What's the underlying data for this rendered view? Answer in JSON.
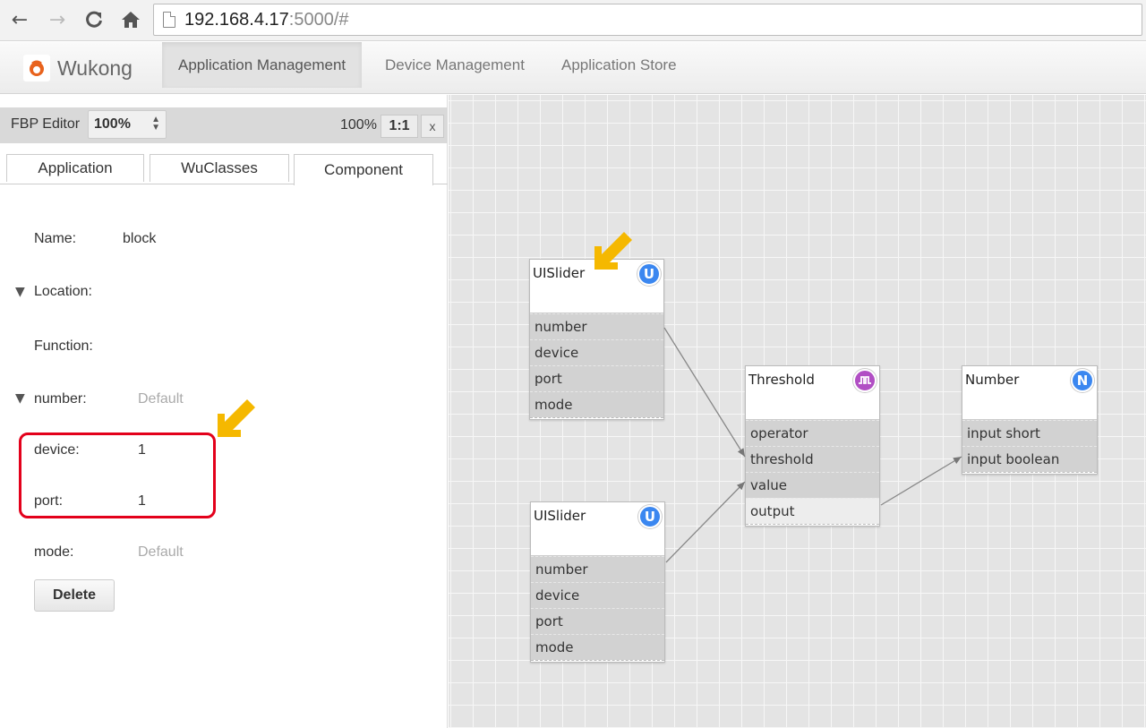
{
  "browser": {
    "back_icon": "arrow-left-icon",
    "forward_icon": "arrow-right-icon",
    "reload_icon": "reload-icon",
    "home_icon": "home-icon",
    "url_host": "192.168.4.17",
    "url_rest": ":5000/#"
  },
  "navbar": {
    "brand": "Wukong",
    "items": [
      {
        "label": "Application Management",
        "active": true
      },
      {
        "label": "Device Management",
        "active": false
      },
      {
        "label": "Application Store",
        "active": false
      }
    ]
  },
  "editor": {
    "label": "FBP Editor",
    "zoom_select": "100%",
    "zoom_pct": "100%",
    "ratio_button": "1:1",
    "close_button": "x",
    "tabs": [
      {
        "label": "Application",
        "active": false
      },
      {
        "label": "WuClasses",
        "active": false
      },
      {
        "label": "Component",
        "active": true
      }
    ]
  },
  "component": {
    "name_label": "Name:",
    "name_value": "block",
    "location_label": "Location:",
    "function_label": "Function:",
    "number_label": "number:",
    "number_value": "Default",
    "device_label": "device:",
    "device_value": "1",
    "port_label": "port:",
    "port_value": "1",
    "mode_label": "mode:",
    "mode_value": "Default",
    "delete_button": "Delete"
  },
  "blocks": [
    {
      "id": "slider1",
      "title": "UISlider",
      "badge": "U",
      "badge_color": "#3b87f0",
      "props": [
        "number",
        "device",
        "port",
        "mode"
      ]
    },
    {
      "id": "slider2",
      "title": "UISlider",
      "badge": "U",
      "badge_color": "#3b87f0",
      "props": [
        "number",
        "device",
        "port",
        "mode"
      ]
    },
    {
      "id": "threshold",
      "title": "Threshold",
      "badge_icon": "threshold-icon",
      "badge_color": "#b14fc4",
      "props": [
        "operator",
        "threshold",
        "value",
        "output"
      ]
    },
    {
      "id": "number",
      "title": "Number",
      "badge": "N",
      "badge_color": "#3b87f0",
      "props": [
        "input short",
        "input boolean"
      ]
    }
  ],
  "annotation_colors": {
    "arrow": "#f5b800",
    "highlight": "#e3001b"
  }
}
